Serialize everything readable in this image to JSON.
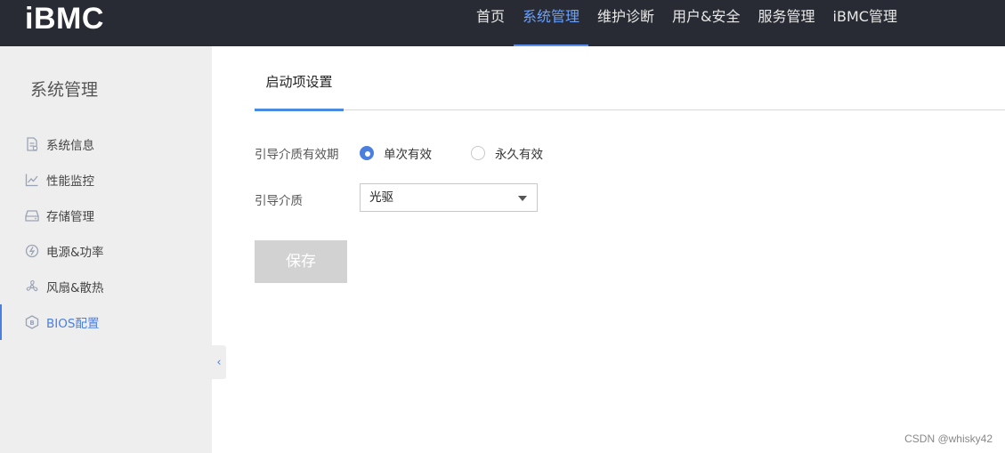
{
  "header": {
    "logo": "iBMC",
    "nav": [
      {
        "label": "首页"
      },
      {
        "label": "系统管理",
        "active": true
      },
      {
        "label": "维护诊断"
      },
      {
        "label": "用户&安全"
      },
      {
        "label": "服务管理"
      },
      {
        "label": "iBMC管理"
      }
    ]
  },
  "sidebar": {
    "title": "系统管理",
    "items": [
      {
        "label": "系统信息",
        "icon": "system-info-icon"
      },
      {
        "label": "性能监控",
        "icon": "chart-line-icon"
      },
      {
        "label": "存储管理",
        "icon": "storage-icon"
      },
      {
        "label": "电源&功率",
        "icon": "power-icon"
      },
      {
        "label": "风扇&散热",
        "icon": "fan-icon"
      },
      {
        "label": "BIOS配置",
        "icon": "bios-icon",
        "active": true
      }
    ],
    "collapse_glyph": "‹"
  },
  "main": {
    "tab": "启动项设置",
    "validity_label": "引导介质有效期",
    "validity_options": [
      {
        "label": "单次有效",
        "checked": true
      },
      {
        "label": "永久有效",
        "checked": false
      }
    ],
    "media_label": "引导介质",
    "media_value": "光驱",
    "save_label": "保存"
  },
  "watermark": "CSDN @whisky42",
  "colors": {
    "topbar_bg": "#282b33",
    "accent": "#4a7fe0",
    "sidebar_bg": "#eeeeee",
    "disabled_button": "#d2d2d2"
  }
}
